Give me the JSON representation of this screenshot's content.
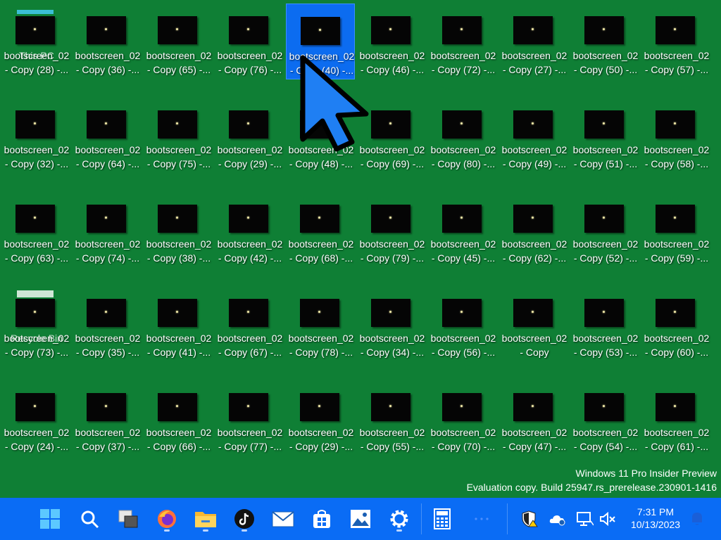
{
  "desktop": {
    "icons": [
      {
        "line1": "bootscreen_02",
        "line2": "- Copy (28) -...",
        "overlay": "This PC"
      },
      {
        "line1": "bootscreen_02",
        "line2": "- Copy (36) -..."
      },
      {
        "line1": "bootscreen_02",
        "line2": "- Copy (65) -..."
      },
      {
        "line1": "bootscreen_02",
        "line2": "- Copy (76) -..."
      },
      {
        "line1": "bootscreen_02",
        "line2": "- Copy (40) -...",
        "selected": true
      },
      {
        "line1": "bootscreen_02",
        "line2": "- Copy (46) -..."
      },
      {
        "line1": "bootscreen_02",
        "line2": "- Copy (72) -..."
      },
      {
        "line1": "bootscreen_02",
        "line2": "- Copy (27) -..."
      },
      {
        "line1": "bootscreen_02",
        "line2": "- Copy (50) -..."
      },
      {
        "line1": "bootscreen_02",
        "line2": "- Copy (57) -..."
      },
      {
        "line1": "bootscreen_02",
        "line2": "- Copy (32) -..."
      },
      {
        "line1": "bootscreen_02",
        "line2": "- Copy (64) -..."
      },
      {
        "line1": "bootscreen_02",
        "line2": "- Copy (75) -..."
      },
      {
        "line1": "bootscreen_02",
        "line2": "- Copy (29) -..."
      },
      {
        "line1": "bootscreen_02",
        "line2": "- Copy (48) -..."
      },
      {
        "line1": "bootscreen_02",
        "line2": "- Copy (69) -..."
      },
      {
        "line1": "bootscreen_02",
        "line2": "- Copy (80) -..."
      },
      {
        "line1": "bootscreen_02",
        "line2": "- Copy (49) -..."
      },
      {
        "line1": "bootscreen_02",
        "line2": "- Copy (51) -..."
      },
      {
        "line1": "bootscreen_02",
        "line2": "- Copy (58) -..."
      },
      {
        "line1": "bootscreen_02",
        "line2": "- Copy (63) -..."
      },
      {
        "line1": "bootscreen_02",
        "line2": "- Copy (74) -..."
      },
      {
        "line1": "bootscreen_02",
        "line2": "- Copy (38) -..."
      },
      {
        "line1": "bootscreen_02",
        "line2": "- Copy (42) -..."
      },
      {
        "line1": "bootscreen_02",
        "line2": "- Copy (68) -..."
      },
      {
        "line1": "bootscreen_02",
        "line2": "- Copy (79) -..."
      },
      {
        "line1": "bootscreen_02",
        "line2": "- Copy (45) -..."
      },
      {
        "line1": "bootscreen_02",
        "line2": "- Copy (62) -..."
      },
      {
        "line1": "bootscreen_02",
        "line2": "- Copy (52) -..."
      },
      {
        "line1": "bootscreen_02",
        "line2": "- Copy (59) -..."
      },
      {
        "line1": "bootscreen_02",
        "line2": "- Copy (73) -...",
        "overlay": "Recycle Bin"
      },
      {
        "line1": "bootscreen_02",
        "line2": "- Copy (35) -..."
      },
      {
        "line1": "bootscreen_02",
        "line2": "- Copy (41) -..."
      },
      {
        "line1": "bootscreen_02",
        "line2": "- Copy (67) -..."
      },
      {
        "line1": "bootscreen_02",
        "line2": "- Copy (78) -..."
      },
      {
        "line1": "bootscreen_02",
        "line2": "- Copy (34) -..."
      },
      {
        "line1": "bootscreen_02",
        "line2": "- Copy (56) -..."
      },
      {
        "line1": "bootscreen_02",
        "line2": "- Copy"
      },
      {
        "line1": "bootscreen_02",
        "line2": "- Copy (53) -..."
      },
      {
        "line1": "bootscreen_02",
        "line2": "- Copy (60) -..."
      },
      {
        "line1": "bootscreen_02",
        "line2": "- Copy (24) -..."
      },
      {
        "line1": "bootscreen_02",
        "line2": "- Copy (37) -..."
      },
      {
        "line1": "bootscreen_02",
        "line2": "- Copy (66) -..."
      },
      {
        "line1": "bootscreen_02",
        "line2": "- Copy (77) -..."
      },
      {
        "line1": "bootscreen_02",
        "line2": "- Copy (29) -..."
      },
      {
        "line1": "bootscreen_02",
        "line2": "- Copy (55) -..."
      },
      {
        "line1": "bootscreen_02",
        "line2": "- Copy (70) -..."
      },
      {
        "line1": "bootscreen_02",
        "line2": "- Copy (47) -..."
      },
      {
        "line1": "bootscreen_02",
        "line2": "- Copy (54) -..."
      },
      {
        "line1": "bootscreen_02",
        "line2": "- Copy (61) -..."
      }
    ]
  },
  "watermark": {
    "line1": "Windows 11 Pro Insider Preview",
    "line2": "Evaluation copy. Build 25947.rs_prerelease.230901-1416"
  },
  "taskbar": {
    "apps": [
      {
        "name": "start-button",
        "icon": "windows-logo-icon"
      },
      {
        "name": "search-button",
        "icon": "search-icon"
      },
      {
        "name": "task-view-button",
        "icon": "task-view-icon"
      },
      {
        "name": "firefox-button",
        "icon": "firefox-icon"
      },
      {
        "name": "file-explorer-button",
        "icon": "folder-icon"
      },
      {
        "name": "tiktok-button",
        "icon": "tiktok-icon"
      },
      {
        "name": "mail-button",
        "icon": "mail-icon"
      },
      {
        "name": "store-button",
        "icon": "store-icon"
      },
      {
        "name": "photos-button",
        "icon": "photos-icon"
      },
      {
        "name": "settings-button",
        "icon": "gear-icon"
      },
      {
        "name": "calculator-button",
        "icon": "calculator-icon"
      }
    ],
    "tray": [
      "security-warning-icon",
      "onedrive-icon",
      "network-icon",
      "volume-muted-icon"
    ],
    "clock": {
      "time": "7:31 PM",
      "date": "10/13/2023"
    },
    "colors": {
      "background": "#0a6cf5",
      "desktop": "#0f7f35"
    }
  }
}
